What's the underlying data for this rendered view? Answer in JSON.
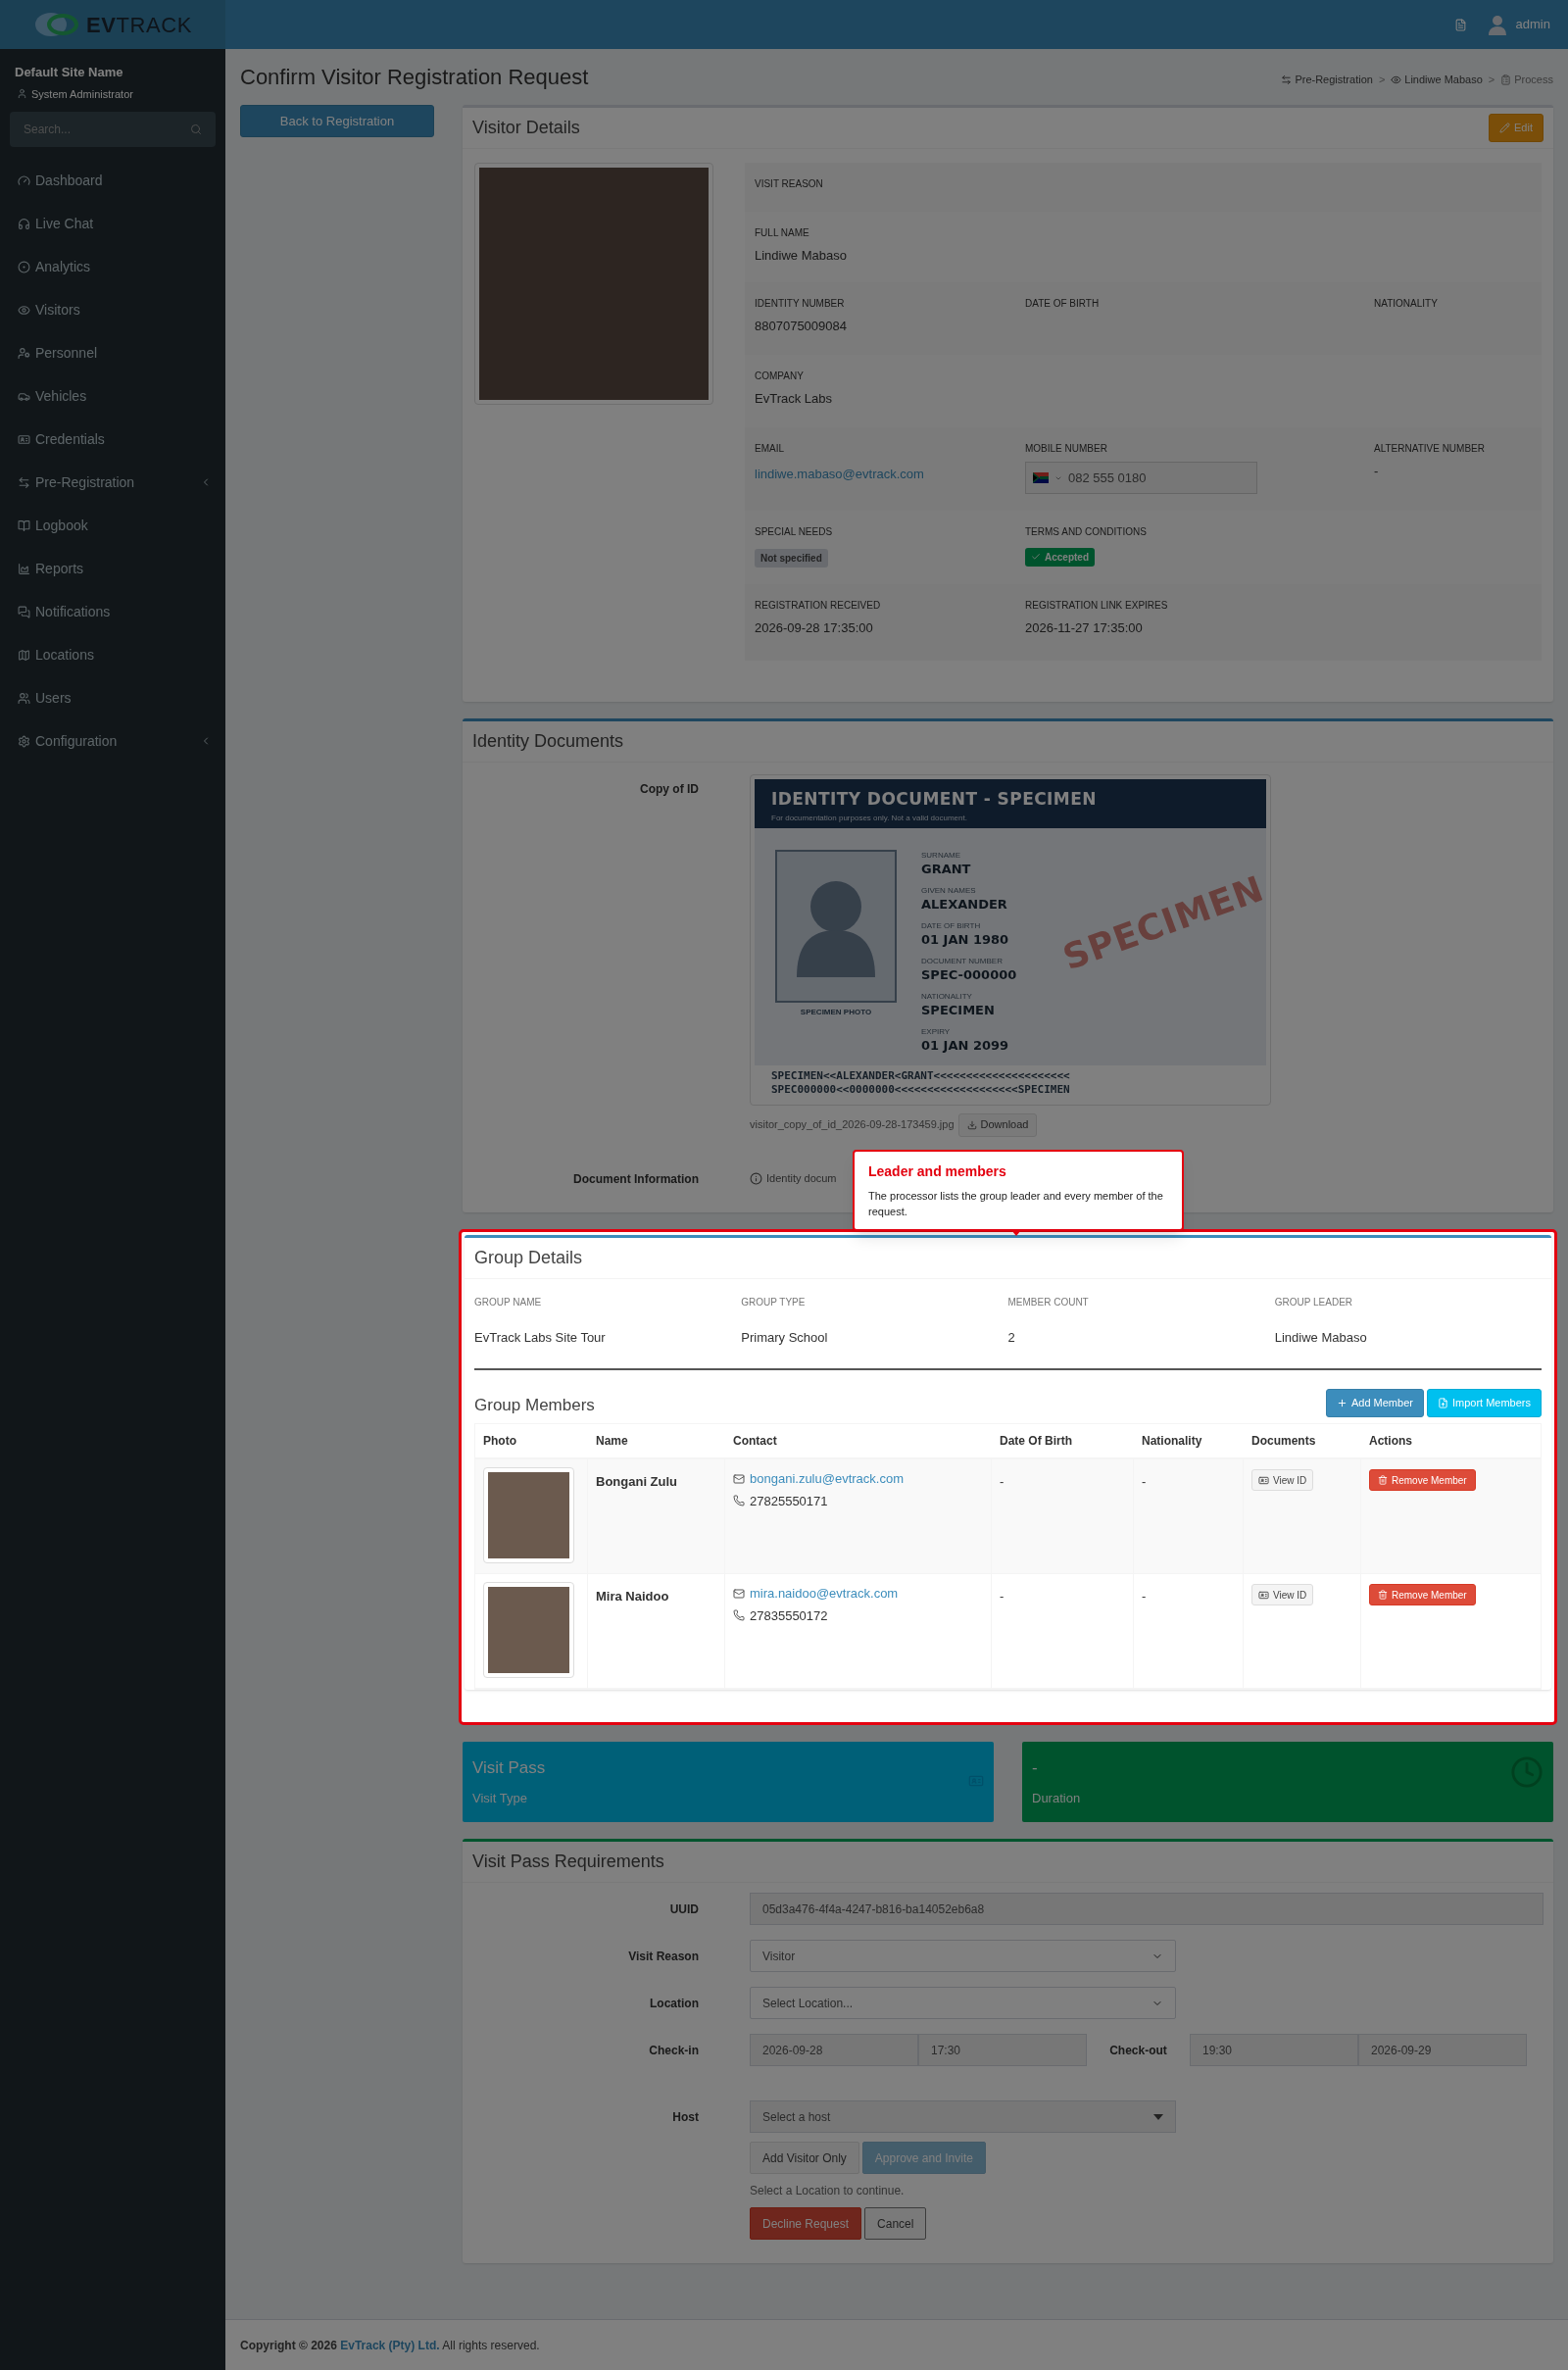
{
  "header": {
    "logo": "**EV**TRACK",
    "user": "admin"
  },
  "sidebar": {
    "site_name": "Default Site Name",
    "role": "System Administrator",
    "search": {
      "placeholder": "Search..."
    },
    "items": [
      {
        "label": "Dashboard",
        "has_submenu": false
      },
      {
        "label": "Live Chat",
        "has_submenu": false
      },
      {
        "label": "Analytics",
        "has_submenu": false
      },
      {
        "label": "Visitors",
        "has_submenu": false
      },
      {
        "label": "Personnel",
        "has_submenu": false
      },
      {
        "label": "Vehicles",
        "has_submenu": false
      },
      {
        "label": "Credentials",
        "has_submenu": false
      },
      {
        "label": "Pre-Registration",
        "has_submenu": true
      },
      {
        "label": "Logbook",
        "has_submenu": false
      },
      {
        "label": "Reports",
        "has_submenu": false
      },
      {
        "label": "Notifications",
        "has_submenu": false
      },
      {
        "label": "Locations",
        "has_submenu": false
      },
      {
        "label": "Users",
        "has_submenu": false
      },
      {
        "label": "Configuration",
        "has_submenu": true
      }
    ]
  },
  "page": {
    "title": "Confirm Visitor Registration Request",
    "back_button": "Back to Registration",
    "breadcrumb": [
      {
        "label": "Pre-Registration",
        "active": false
      },
      {
        "label": "Lindiwe Mabaso",
        "active": false
      },
      {
        "label": "Process",
        "active": true
      }
    ],
    "breadcrumb_separators": [
      ">",
      ">"
    ]
  },
  "visitor_details": {
    "title": "Visitor Details",
    "edit_button": "Edit",
    "rows": [
      [
        {
          "label": "VISIT REASON",
          "kind": "text"
        }
      ],
      [
        {
          "label": "FULL NAME",
          "value": "Lindiwe Mabaso",
          "kind": "text"
        }
      ],
      [
        {
          "label": "IDENTITY NUMBER",
          "value": "8807075009084",
          "kind": "text"
        },
        {
          "label": "DATE OF BIRTH",
          "kind": "text"
        },
        {
          "label": "NATIONALITY",
          "kind": "text"
        }
      ],
      [
        {
          "label": "COMPANY",
          "value": "EvTrack Labs",
          "kind": "text"
        }
      ],
      [
        {
          "label": "EMAIL",
          "value": "lindiwe.mabaso@evtrack.com",
          "kind": "link"
        },
        {
          "label": "MOBILE NUMBER",
          "value": "082 555 0180",
          "kind": "phone"
        },
        {
          "label": "ALTERNATIVE NUMBER",
          "value": "-",
          "kind": "text"
        }
      ],
      [
        {
          "label": "SPECIAL NEEDS",
          "value": "Not specified",
          "kind": "badge"
        },
        {
          "label": "TERMS AND CONDITIONS",
          "value": "Accepted",
          "kind": "status"
        }
      ],
      [
        {
          "label": "REGISTRATION RECEIVED",
          "value": "2026-09-28 17:35:00",
          "kind": "text"
        },
        {
          "label": "REGISTRATION LINK EXPIRES",
          "value": "2026-11-27 17:35:00",
          "kind": "text"
        }
      ]
    ]
  },
  "identity_documents": {
    "title": "Identity Documents",
    "copy_label": "Copy of ID",
    "id_card": {
      "title": "IDENTITY DOCUMENT - SPECIMEN",
      "subtitle": "For documentation purposes only. Not a valid document.",
      "photo_caption": "SPECIMEN PHOTO",
      "watermark": "SPECIMEN",
      "fields": [
        {
          "label": "SURNAME",
          "value": "GRANT"
        },
        {
          "label": "GIVEN NAMES",
          "value": "ALEXANDER"
        },
        {
          "label": "DATE OF BIRTH",
          "value": "01 JAN 1980"
        },
        {
          "label": "DOCUMENT NUMBER",
          "value": "SPEC-000000"
        },
        {
          "label": "NATIONALITY",
          "value": "SPECIMEN"
        },
        {
          "label": "EXPIRY",
          "value": "01 JAN 2099"
        }
      ],
      "mrz": [
        "SPECIMEN<<ALEXANDER<GRANT<<<<<<<<<<<<<<<<<<<<<",
        "SPEC000000<<0000000<<<<<<<<<<<<<<<<<<<SPECIMEN"
      ]
    },
    "file_name": "visitor_copy_of_id_2026-09-28-173459.jpg",
    "download_button": "Download",
    "info_label": "Document Information",
    "info_text": "Identity docum"
  },
  "tooltip": {
    "title": "Leader and members",
    "text": "The processor lists the group leader and every member of the request."
  },
  "group": {
    "title": "Group Details",
    "fields": [
      {
        "label": "GROUP NAME",
        "value": "EvTrack Labs Site Tour"
      },
      {
        "label": "GROUP TYPE",
        "value": "Primary School"
      },
      {
        "label": "MEMBER COUNT",
        "value": "2"
      },
      {
        "label": "GROUP LEADER",
        "value": "Lindiwe Mabaso"
      }
    ],
    "members_title": "Group Members",
    "add_button": "Add Member",
    "import_button": "Import Members",
    "columns": [
      "Photo",
      "Name",
      "Contact",
      "Date Of Birth",
      "Nationality",
      "Documents",
      "Actions"
    ],
    "members": [
      {
        "name": "Bongani Zulu",
        "email": "bongani.zulu@evtrack.com",
        "phone": "27825550171",
        "dob": "-",
        "nationality": "-",
        "documents_button": "View ID",
        "action_button": "Remove Member"
      },
      {
        "name": "Mira Naidoo",
        "email": "mira.naidoo@evtrack.com",
        "phone": "27835550172",
        "dob": "-",
        "nationality": "-",
        "documents_button": "View ID",
        "action_button": "Remove Member"
      }
    ]
  },
  "tiles": [
    {
      "title": "Visit Pass",
      "subtitle": "Visit Type",
      "color": "#006078"
    },
    {
      "title": "-",
      "subtitle": "Duration",
      "color": "#00532d"
    }
  ],
  "requirements": {
    "title": "Visit Pass Requirements",
    "uuid": {
      "label": "UUID",
      "value": "05d3a476-4f4a-4247-b816-ba14052eb6a8"
    },
    "visit_reason": {
      "label": "Visit Reason",
      "value": "Visitor"
    },
    "location": {
      "label": "Location",
      "value": "Select Location..."
    },
    "check_in": {
      "label": "Check-in",
      "date": "2026-09-28",
      "time": "17:30"
    },
    "check_out": {
      "label": "Check-out",
      "time": "19:30",
      "date": "2026-09-29"
    },
    "host": {
      "label": "Host",
      "value": "Select a host"
    },
    "actions": [
      {
        "label": "Add Visitor Only",
        "kind": "default",
        "disabled": false
      },
      {
        "label": "Approve and Invite",
        "kind": "primary",
        "disabled": true
      }
    ],
    "hint": "Select a Location to continue.",
    "decline_button": "Decline Request",
    "cancel_button": "Cancel"
  },
  "footer": {
    "prefix": "Copyright © 2026",
    "link": "EvTrack (Pty) Ltd.",
    "suffix": "All rights reserved."
  }
}
